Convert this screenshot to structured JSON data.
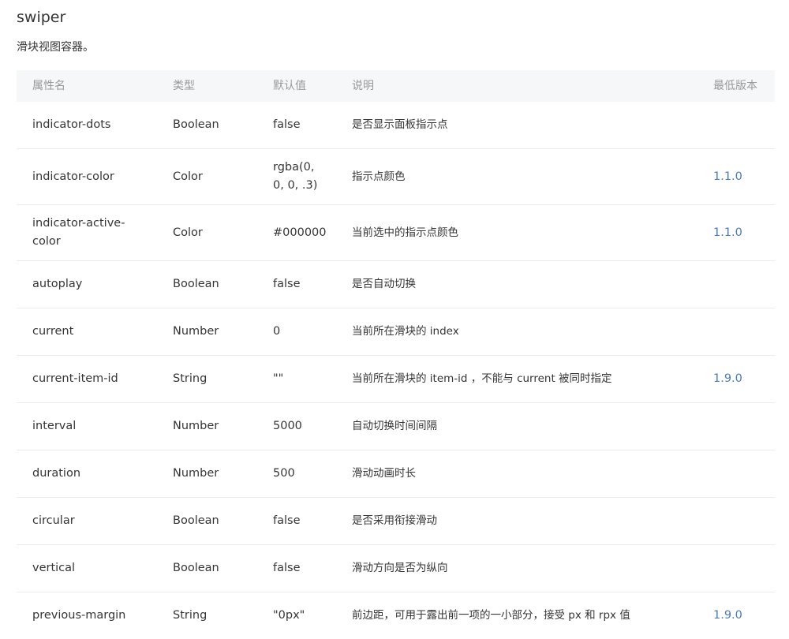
{
  "page": {
    "title": "swiper",
    "description": "滑块视图容器。"
  },
  "table": {
    "headers": {
      "name": "属性名",
      "type": "类型",
      "default": "默认值",
      "desc": "说明",
      "version": "最低版本"
    },
    "rows": [
      {
        "name": "indicator-dots",
        "type": "Boolean",
        "default": "false",
        "desc": "是否显示面板指示点",
        "version": ""
      },
      {
        "name": "indicator-color",
        "type": "Color",
        "default": "rgba(0, 0, 0, .3)",
        "desc": "指示点颜色",
        "version": "1.1.0"
      },
      {
        "name": "indicator-active-color",
        "type": "Color",
        "default": "#000000",
        "desc": "当前选中的指示点颜色",
        "version": "1.1.0"
      },
      {
        "name": "autoplay",
        "type": "Boolean",
        "default": "false",
        "desc": "是否自动切换",
        "version": ""
      },
      {
        "name": "current",
        "type": "Number",
        "default": "0",
        "desc": "当前所在滑块的 index",
        "version": ""
      },
      {
        "name": "current-item-id",
        "type": "String",
        "default": "\"\"",
        "desc": "当前所在滑块的 item-id ，不能与 current 被同时指定",
        "version": "1.9.0"
      },
      {
        "name": "interval",
        "type": "Number",
        "default": "5000",
        "desc": "自动切换时间间隔",
        "version": ""
      },
      {
        "name": "duration",
        "type": "Number",
        "default": "500",
        "desc": "滑动动画时长",
        "version": ""
      },
      {
        "name": "circular",
        "type": "Boolean",
        "default": "false",
        "desc": "是否采用衔接滑动",
        "version": ""
      },
      {
        "name": "vertical",
        "type": "Boolean",
        "default": "false",
        "desc": "滑动方向是否为纵向",
        "version": ""
      },
      {
        "name": "previous-margin",
        "type": "String",
        "default": "\"0px\"",
        "desc": "前边距，可用于露出前一项的一小部分，接受 px 和 rpx 值",
        "version": "1.9.0"
      }
    ]
  },
  "colors": {
    "link": "#4a7cb6",
    "header_bg": "#f6f7f9",
    "divider": "#e9ebee"
  }
}
